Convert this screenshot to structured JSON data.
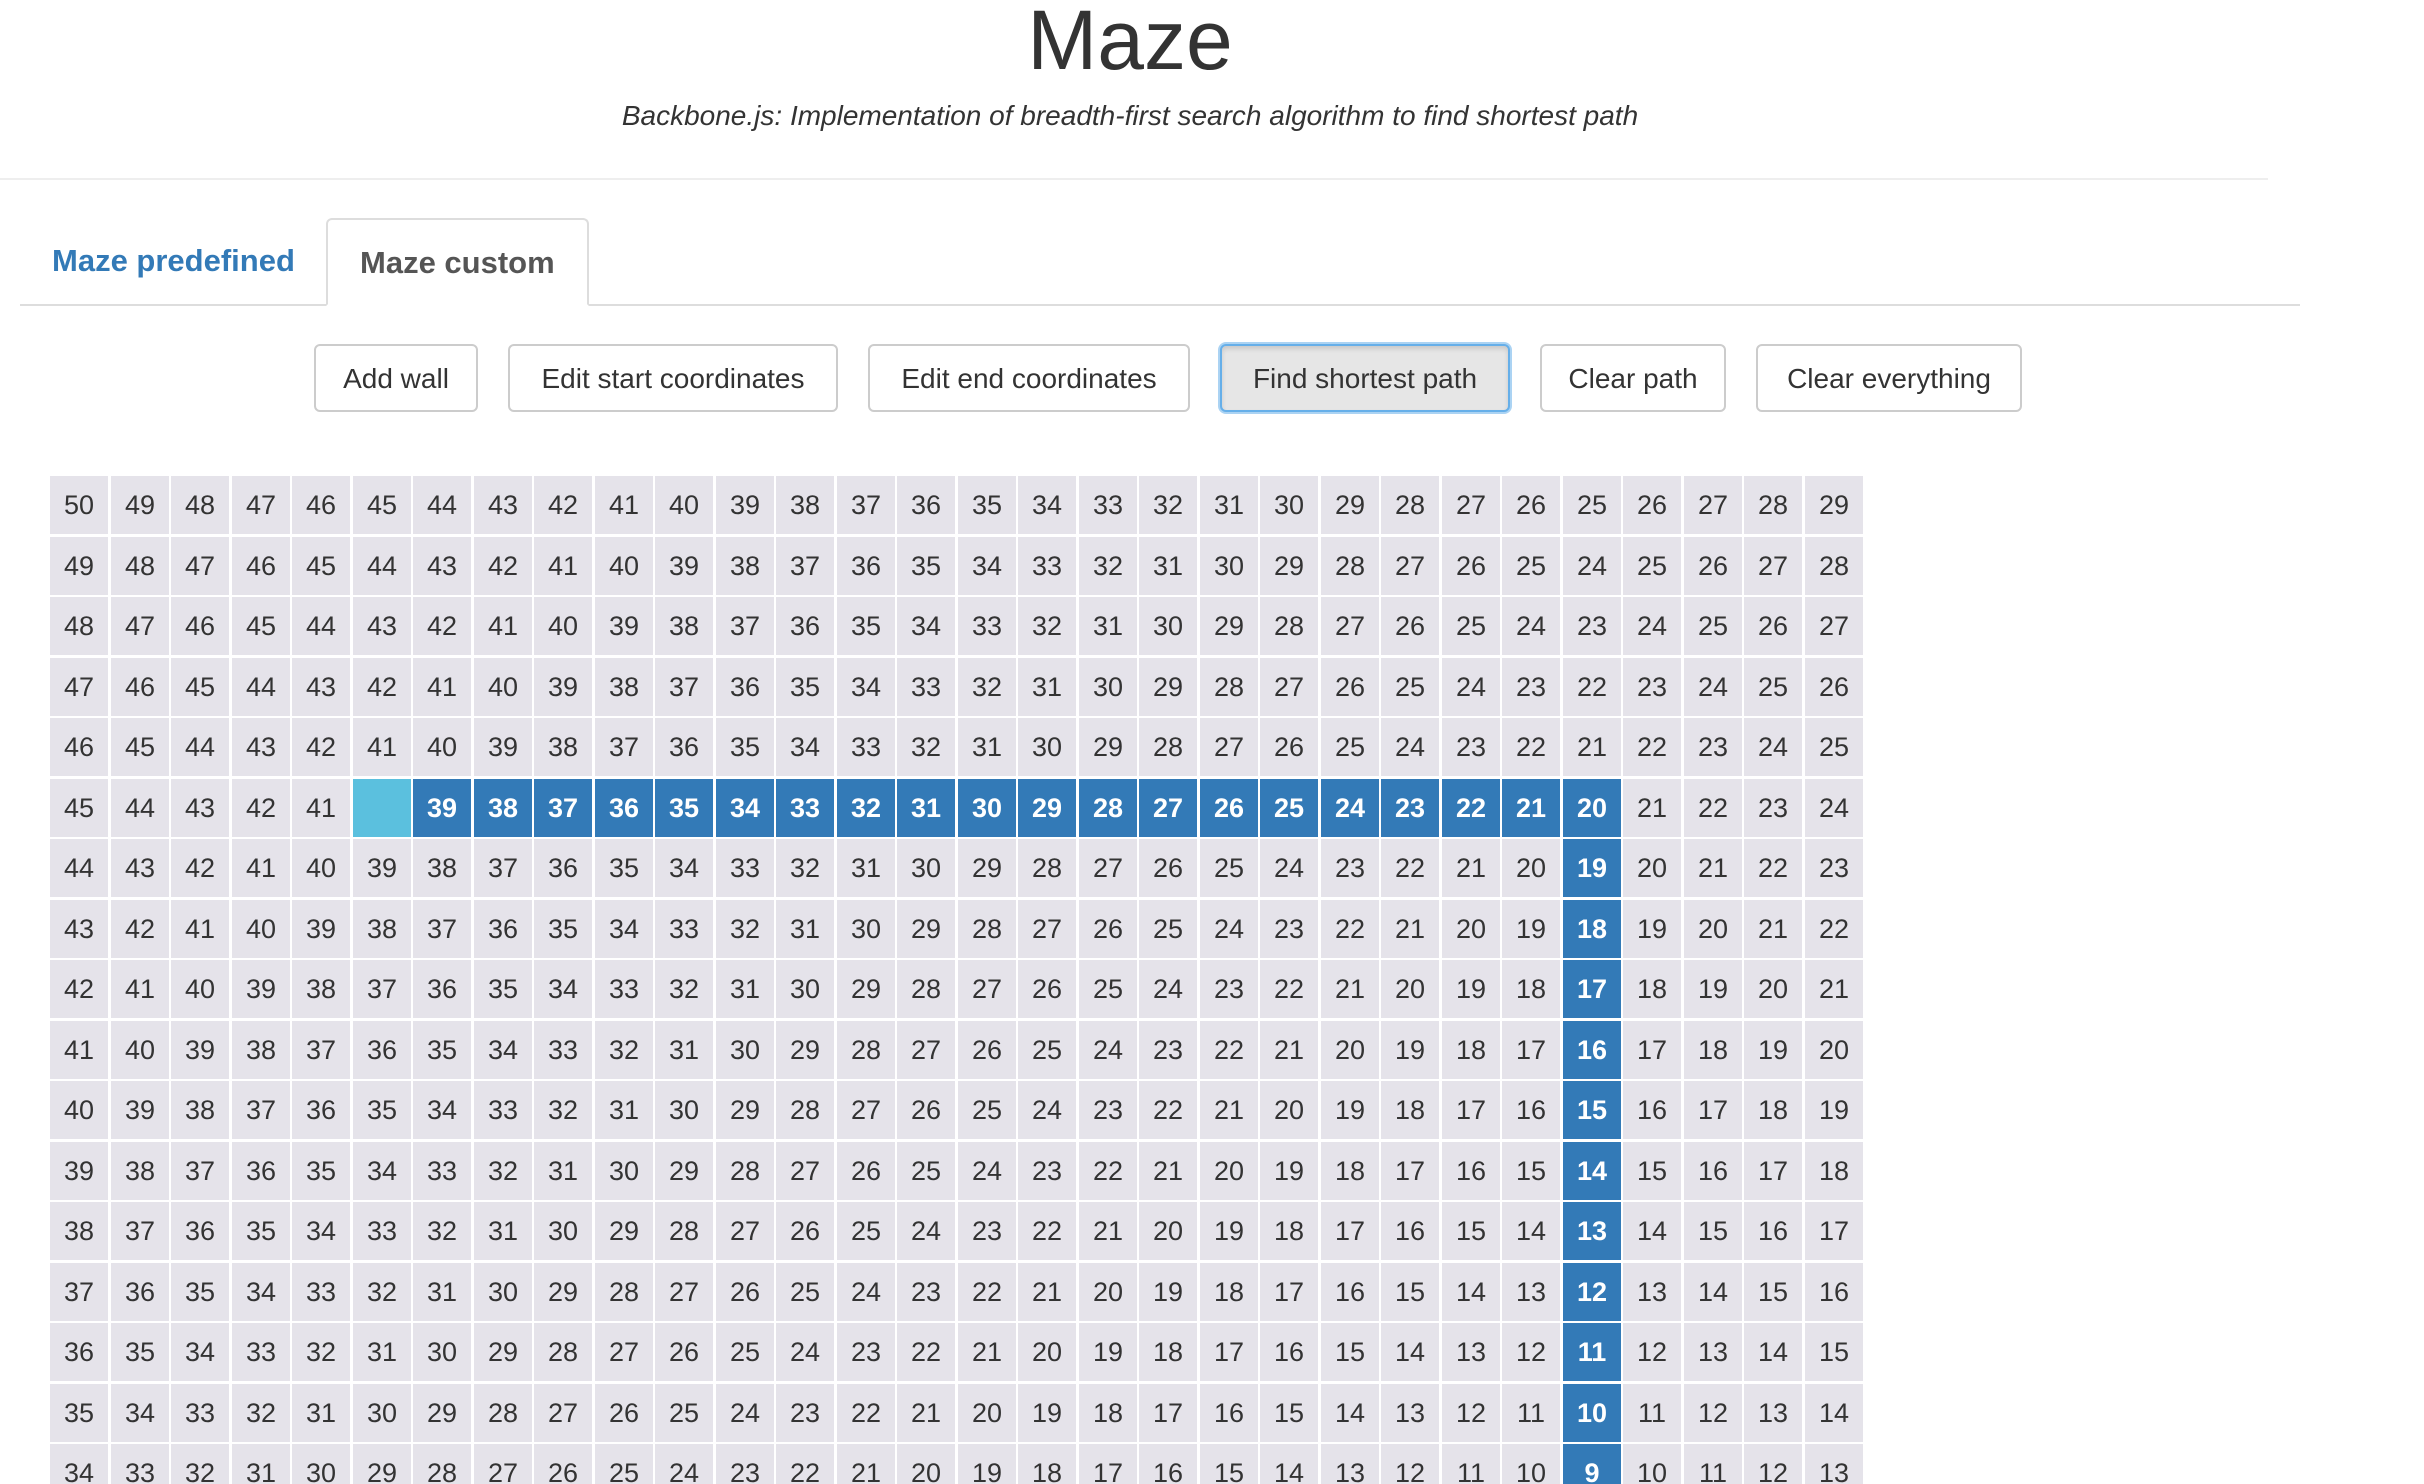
{
  "header": {
    "title": "Maze",
    "subtitle": "Backbone.js: Implementation of breadth-first search algorithm to find shortest path"
  },
  "tabs": [
    {
      "label": "Maze predefined",
      "active": false
    },
    {
      "label": "Maze custom",
      "active": true
    }
  ],
  "toolbar": {
    "add_wall": "Add wall",
    "edit_start": "Edit start coordinates",
    "edit_end": "Edit end coordinates",
    "find_path": "Find shortest path",
    "clear_path": "Clear path",
    "clear_everything": "Clear everything",
    "active_button": "find_path"
  },
  "colors": {
    "cell": "#e5e3ea",
    "path": "#337ab7",
    "start": "#5bc0de",
    "tab_link": "#337ab7"
  },
  "maze": {
    "columns": 30,
    "visible_rows": 17,
    "start_cell": [
      5,
      5
    ],
    "rows": [
      [
        50,
        49,
        48,
        47,
        46,
        45,
        44,
        43,
        42,
        41,
        40,
        39,
        38,
        37,
        36,
        35,
        34,
        33,
        32,
        31,
        30,
        29,
        28,
        27,
        26,
        25,
        26,
        27,
        28,
        29
      ],
      [
        49,
        48,
        47,
        46,
        45,
        44,
        43,
        42,
        41,
        40,
        39,
        38,
        37,
        36,
        35,
        34,
        33,
        32,
        31,
        30,
        29,
        28,
        27,
        26,
        25,
        24,
        25,
        26,
        27,
        28
      ],
      [
        48,
        47,
        46,
        45,
        44,
        43,
        42,
        41,
        40,
        39,
        38,
        37,
        36,
        35,
        34,
        33,
        32,
        31,
        30,
        29,
        28,
        27,
        26,
        25,
        24,
        23,
        24,
        25,
        26,
        27
      ],
      [
        47,
        46,
        45,
        44,
        43,
        42,
        41,
        40,
        39,
        38,
        37,
        36,
        35,
        34,
        33,
        32,
        31,
        30,
        29,
        28,
        27,
        26,
        25,
        24,
        23,
        22,
        23,
        24,
        25,
        26
      ],
      [
        46,
        45,
        44,
        43,
        42,
        41,
        40,
        39,
        38,
        37,
        36,
        35,
        34,
        33,
        32,
        31,
        30,
        29,
        28,
        27,
        26,
        25,
        24,
        23,
        22,
        21,
        22,
        23,
        24,
        25
      ],
      [
        45,
        44,
        43,
        42,
        41,
        "",
        39,
        38,
        37,
        36,
        35,
        34,
        33,
        32,
        31,
        30,
        29,
        28,
        27,
        26,
        25,
        24,
        23,
        22,
        21,
        20,
        21,
        22,
        23,
        24
      ],
      [
        44,
        43,
        42,
        41,
        40,
        39,
        38,
        37,
        36,
        35,
        34,
        33,
        32,
        31,
        30,
        29,
        28,
        27,
        26,
        25,
        24,
        23,
        22,
        21,
        20,
        19,
        20,
        21,
        22,
        23
      ],
      [
        43,
        42,
        41,
        40,
        39,
        38,
        37,
        36,
        35,
        34,
        33,
        32,
        31,
        30,
        29,
        28,
        27,
        26,
        25,
        24,
        23,
        22,
        21,
        20,
        19,
        18,
        19,
        20,
        21,
        22
      ],
      [
        42,
        41,
        40,
        39,
        38,
        37,
        36,
        35,
        34,
        33,
        32,
        31,
        30,
        29,
        28,
        27,
        26,
        25,
        24,
        23,
        22,
        21,
        20,
        19,
        18,
        17,
        18,
        19,
        20,
        21
      ],
      [
        41,
        40,
        39,
        38,
        37,
        36,
        35,
        34,
        33,
        32,
        31,
        30,
        29,
        28,
        27,
        26,
        25,
        24,
        23,
        22,
        21,
        20,
        19,
        18,
        17,
        16,
        17,
        18,
        19,
        20
      ],
      [
        40,
        39,
        38,
        37,
        36,
        35,
        34,
        33,
        32,
        31,
        30,
        29,
        28,
        27,
        26,
        25,
        24,
        23,
        22,
        21,
        20,
        19,
        18,
        17,
        16,
        15,
        16,
        17,
        18,
        19
      ],
      [
        39,
        38,
        37,
        36,
        35,
        34,
        33,
        32,
        31,
        30,
        29,
        28,
        27,
        26,
        25,
        24,
        23,
        22,
        21,
        20,
        19,
        18,
        17,
        16,
        15,
        14,
        15,
        16,
        17,
        18
      ],
      [
        38,
        37,
        36,
        35,
        34,
        33,
        32,
        31,
        30,
        29,
        28,
        27,
        26,
        25,
        24,
        23,
        22,
        21,
        20,
        19,
        18,
        17,
        16,
        15,
        14,
        13,
        14,
        15,
        16,
        17
      ],
      [
        37,
        36,
        35,
        34,
        33,
        32,
        31,
        30,
        29,
        28,
        27,
        26,
        25,
        24,
        23,
        22,
        21,
        20,
        19,
        18,
        17,
        16,
        15,
        14,
        13,
        12,
        13,
        14,
        15,
        16
      ],
      [
        36,
        35,
        34,
        33,
        32,
        31,
        30,
        29,
        28,
        27,
        26,
        25,
        24,
        23,
        22,
        21,
        20,
        19,
        18,
        17,
        16,
        15,
        14,
        13,
        12,
        11,
        12,
        13,
        14,
        15
      ],
      [
        35,
        34,
        33,
        32,
        31,
        30,
        29,
        28,
        27,
        26,
        25,
        24,
        23,
        22,
        21,
        20,
        19,
        18,
        17,
        16,
        15,
        14,
        13,
        12,
        11,
        10,
        11,
        12,
        13,
        14
      ],
      [
        34,
        33,
        32,
        31,
        30,
        29,
        28,
        27,
        26,
        25,
        24,
        23,
        22,
        21,
        20,
        19,
        18,
        17,
        16,
        15,
        14,
        13,
        12,
        11,
        10,
        9,
        10,
        11,
        12,
        13
      ]
    ],
    "path_cells": [
      [
        5,
        6
      ],
      [
        5,
        7
      ],
      [
        5,
        8
      ],
      [
        5,
        9
      ],
      [
        5,
        10
      ],
      [
        5,
        11
      ],
      [
        5,
        12
      ],
      [
        5,
        13
      ],
      [
        5,
        14
      ],
      [
        5,
        15
      ],
      [
        5,
        16
      ],
      [
        5,
        17
      ],
      [
        5,
        18
      ],
      [
        5,
        19
      ],
      [
        5,
        20
      ],
      [
        5,
        21
      ],
      [
        5,
        22
      ],
      [
        5,
        23
      ],
      [
        5,
        24
      ],
      [
        5,
        25
      ],
      [
        6,
        25
      ],
      [
        7,
        25
      ],
      [
        8,
        25
      ],
      [
        9,
        25
      ],
      [
        10,
        25
      ],
      [
        11,
        25
      ],
      [
        12,
        25
      ],
      [
        13,
        25
      ],
      [
        14,
        25
      ],
      [
        15,
        25
      ],
      [
        16,
        25
      ]
    ]
  }
}
